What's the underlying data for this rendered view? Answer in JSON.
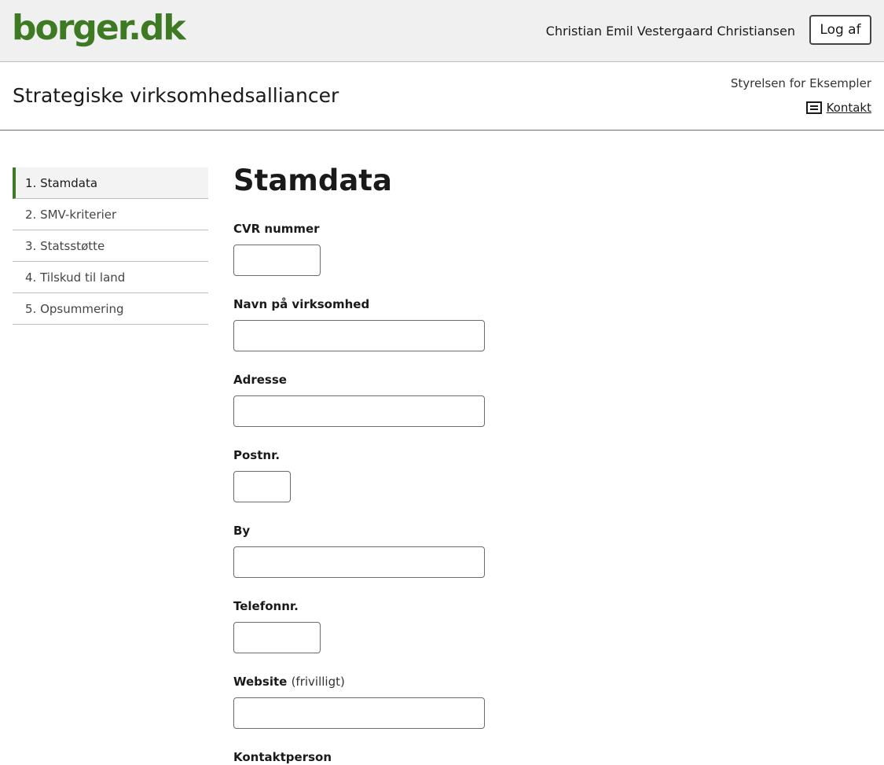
{
  "header": {
    "logo": "borger.dk",
    "user_name": "Christian Emil Vestergaard Christiansen",
    "logout_label": "Log af"
  },
  "service": {
    "title": "Strategiske virksomhedsalliancer",
    "agency": "Styrelsen for Eksempler",
    "contact_label": "Kontakt",
    "contact_icon": "contact-card-icon"
  },
  "sidebar": {
    "items": [
      {
        "label": "1. Stamdata",
        "active": true
      },
      {
        "label": "2. SMV-kriterier",
        "active": false
      },
      {
        "label": "3. Statsstøtte",
        "active": false
      },
      {
        "label": "4. Tilskud til land",
        "active": false
      },
      {
        "label": "5. Opsummering",
        "active": false
      }
    ]
  },
  "form": {
    "title": "Stamdata",
    "fields": [
      {
        "label": "CVR nummer",
        "value": ""
      },
      {
        "label": "Navn på virksomhed",
        "value": ""
      },
      {
        "label": "Adresse",
        "value": ""
      },
      {
        "label": "Postnr.",
        "value": ""
      },
      {
        "label": "By",
        "value": ""
      },
      {
        "label": "Telefonnr.",
        "value": ""
      },
      {
        "label": "Website",
        "optional": "(frivilligt)",
        "value": ""
      },
      {
        "label": "Kontaktperson",
        "value": ""
      }
    ]
  },
  "colors": {
    "brand_green": "#3e7a24",
    "topbar_bg": "#f0f0f0"
  }
}
